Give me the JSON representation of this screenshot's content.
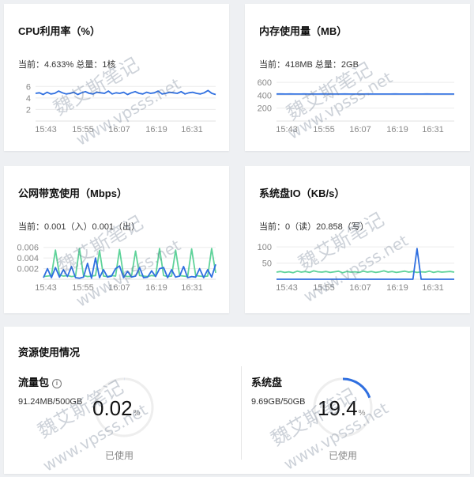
{
  "cards": {
    "cpu": {
      "title": "CPU利用率（%）",
      "stat_current_label": "当前：",
      "stat_current_value": "4.633%",
      "stat_total_label": "总量：",
      "stat_total_value": "1核",
      "colors": [
        "#2f6fe0"
      ]
    },
    "mem": {
      "title": "内存使用量（MB）",
      "stat_current_label": "当前：",
      "stat_current_value": "418MB",
      "stat_total_label": "总量：",
      "stat_total_value": "2GB",
      "colors": [
        "#2f6fe0"
      ]
    },
    "net": {
      "title": "公网带宽使用（Mbps）",
      "stat_current_label": "当前：",
      "stat_current_value": "0.001（入）0.001（出）",
      "stat_total_label": "",
      "stat_total_value": "",
      "colors": [
        "#5fd39a",
        "#2f6fe0"
      ]
    },
    "disk": {
      "title": "系统盘IO（KB/s）",
      "stat_current_label": "当前：",
      "stat_current_value": "0（读）20.858（写）",
      "stat_total_label": "",
      "stat_total_value": "",
      "colors": [
        "#5fd39a",
        "#2f6fe0"
      ]
    }
  },
  "chart_data": [
    {
      "id": "cpu",
      "type": "line",
      "x_ticks": [
        "15:43",
        "15:55",
        "16:07",
        "16:19",
        "16:31"
      ],
      "y_ticks": [
        6,
        4,
        2
      ],
      "ylim": [
        0,
        7
      ],
      "series": [
        {
          "values": [
            4.8,
            4.9,
            4.6,
            5.0,
            4.7,
            4.8,
            5.2,
            4.9,
            4.7,
            4.8,
            5.0,
            4.6,
            4.9,
            5.1,
            4.8,
            4.7,
            5.0,
            4.9,
            4.8,
            5.2,
            4.7,
            4.9,
            4.8,
            5.0,
            4.6,
            4.9,
            5.1,
            4.8,
            4.7,
            5.0,
            4.8,
            4.9,
            5.2,
            4.7,
            4.8,
            5.0,
            4.9,
            4.8,
            5.1,
            4.7,
            4.9,
            5.0,
            4.8,
            4.7,
            4.9,
            5.3,
            4.8,
            4.6
          ]
        }
      ]
    },
    {
      "id": "mem",
      "type": "line",
      "x_ticks": [
        "15:43",
        "15:55",
        "16:07",
        "16:19",
        "16:31"
      ],
      "y_ticks": [
        600,
        400,
        200
      ],
      "ylim": [
        0,
        650
      ],
      "series": [
        {
          "values": [
            420,
            419,
            418,
            419,
            418,
            418,
            419,
            418,
            418,
            418,
            419,
            418,
            418,
            418,
            418,
            419,
            418,
            418,
            418,
            418,
            419,
            418,
            418,
            418,
            418,
            418,
            419,
            418,
            418,
            418,
            418,
            418,
            418,
            419,
            418,
            418,
            418,
            418,
            418,
            418
          ]
        }
      ]
    },
    {
      "id": "net",
      "type": "line",
      "x_ticks": [
        "15:43",
        "15:55",
        "16:07",
        "16:19",
        "16:31"
      ],
      "y_ticks": [
        0.006,
        0.004,
        0.002
      ],
      "ylim": [
        0,
        0.007
      ],
      "series": [
        {
          "values": [
            0.0005,
            0.0006,
            0.0007,
            0.0055,
            0.0008,
            0.0006,
            0.0007,
            0.0005,
            0.0006,
            0.0058,
            0.0007,
            0.0005,
            0.0006,
            0.0007,
            0.0054,
            0.0006,
            0.0005,
            0.0007,
            0.0006,
            0.0056,
            0.0007,
            0.0005,
            0.0006,
            0.0053,
            0.0007,
            0.0006,
            0.0005,
            0.0007,
            0.0006,
            0.0058,
            0.0007,
            0.0005,
            0.0006,
            0.0055,
            0.0007,
            0.0006,
            0.0005,
            0.0057,
            0.0007,
            0.0006,
            0.0005,
            0.0006,
            0.0058,
            0.0012
          ]
        },
        {
          "values": [
            0.0003,
            0.002,
            0.0003,
            0.0022,
            0.0004,
            0.0018,
            0.0005,
            0.0024,
            0.0003,
            0.0002,
            0.0004,
            0.003,
            0.0002,
            0.004,
            0.0003,
            0.0018,
            0.0004,
            0.0006,
            0.002,
            0.0025,
            0.0003,
            0.0015,
            0.0004,
            0.0006,
            0.0022,
            0.0003,
            0.0004,
            0.0016,
            0.0005,
            0.002,
            0.0022,
            0.0003,
            0.0018,
            0.0004,
            0.0006,
            0.0024,
            0.0003,
            0.0005,
            0.0004,
            0.002,
            0.0003,
            0.0018,
            0.0004,
            0.0028
          ]
        }
      ]
    },
    {
      "id": "disk",
      "type": "line",
      "x_ticks": [
        "15:43",
        "15:55",
        "16:07",
        "16:19",
        "16:31"
      ],
      "y_ticks": [
        100,
        50
      ],
      "ylim": [
        0,
        115
      ],
      "series": [
        {
          "values": [
            22,
            24,
            21,
            23,
            20,
            25,
            22,
            24,
            21,
            26,
            23,
            22,
            24,
            21,
            23,
            25,
            20,
            24,
            22,
            23,
            21,
            25,
            22,
            24,
            21,
            23,
            26,
            22,
            24,
            21,
            23,
            25,
            22,
            24,
            21,
            23,
            22,
            25,
            21,
            24,
            22,
            23,
            24,
            22
          ]
        },
        {
          "values": [
            0,
            0,
            0,
            0,
            0,
            0,
            0,
            0,
            0,
            0,
            0,
            0,
            0,
            0,
            0,
            0,
            0,
            0,
            0,
            0,
            0,
            0,
            0,
            0,
            0,
            0,
            0,
            0,
            0,
            0,
            0,
            0,
            0,
            0,
            95,
            0,
            0,
            0,
            0,
            0,
            0,
            0,
            0,
            0
          ]
        }
      ]
    }
  ],
  "resource": {
    "title": "资源使用情况",
    "traffic": {
      "name": "流量包",
      "usage": "91.24MB/500GB",
      "value": "0.02",
      "unit": "%",
      "percent": 0.02,
      "used_label": "已使用"
    },
    "disk": {
      "name": "系统盘",
      "usage": "9.69GB/50GB",
      "value": "19.4",
      "unit": "%",
      "percent": 19.4,
      "used_label": "已使用"
    },
    "accent_color": "#2f6fe0",
    "track_color": "#eeeeee"
  },
  "watermark": {
    "text_cn": "魏艾斯笔记",
    "text_url": "www.vpsss.net"
  }
}
